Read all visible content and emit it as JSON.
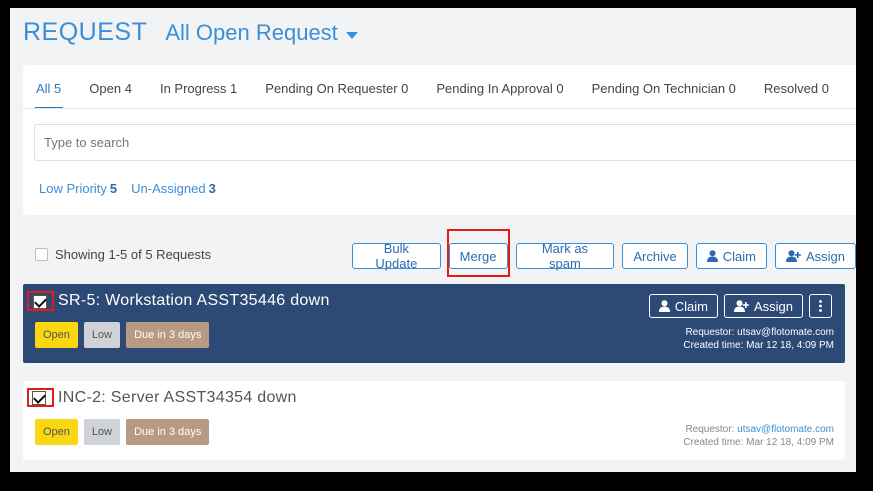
{
  "header": {
    "title": "REQUEST",
    "view_label": "All Open Request"
  },
  "tabs": [
    {
      "label": "All 5",
      "active": true
    },
    {
      "label": "Open 4"
    },
    {
      "label": "In Progress 1"
    },
    {
      "label": "Pending On Requester 0"
    },
    {
      "label": "Pending In Approval 0"
    },
    {
      "label": "Pending On Technician 0"
    },
    {
      "label": "Resolved 0"
    }
  ],
  "search": {
    "placeholder": "Type to search"
  },
  "filters": {
    "low_priority_label": "Low Priority",
    "low_priority_count": "5",
    "unassigned_label": "Un-Assigned",
    "unassigned_count": "3"
  },
  "list": {
    "showing": "Showing 1-5 of 5 Requests"
  },
  "toolbar": {
    "bulk_update": "Bulk Update",
    "merge": "Merge",
    "mark_spam": "Mark as spam",
    "archive": "Archive",
    "claim": "Claim",
    "assign": "Assign"
  },
  "requests": [
    {
      "title": "SR-5: Workstation ASST35446 down",
      "status": "Open",
      "priority": "Low",
      "due": "Due in 3 days",
      "claim_label": "Claim",
      "assign_label": "Assign",
      "requestor_label": "Requestor:",
      "requestor": "utsav@flotomate.com",
      "created_label": "Created time:",
      "created": "Mar 12 18, 4:09 PM"
    },
    {
      "title": "INC-2: Server ASST34354 down",
      "status": "Open",
      "priority": "Low",
      "due": "Due in 3 days",
      "requestor_label": "Requestor:",
      "requestor": "utsav@flotomate.com",
      "created_label": "Created time:",
      "created": "Mar 12 18, 4:09 PM"
    }
  ],
  "colors": {
    "accent": "#3a8fd6",
    "selected_row": "#2c4a75",
    "highlight": "#e41b17"
  }
}
